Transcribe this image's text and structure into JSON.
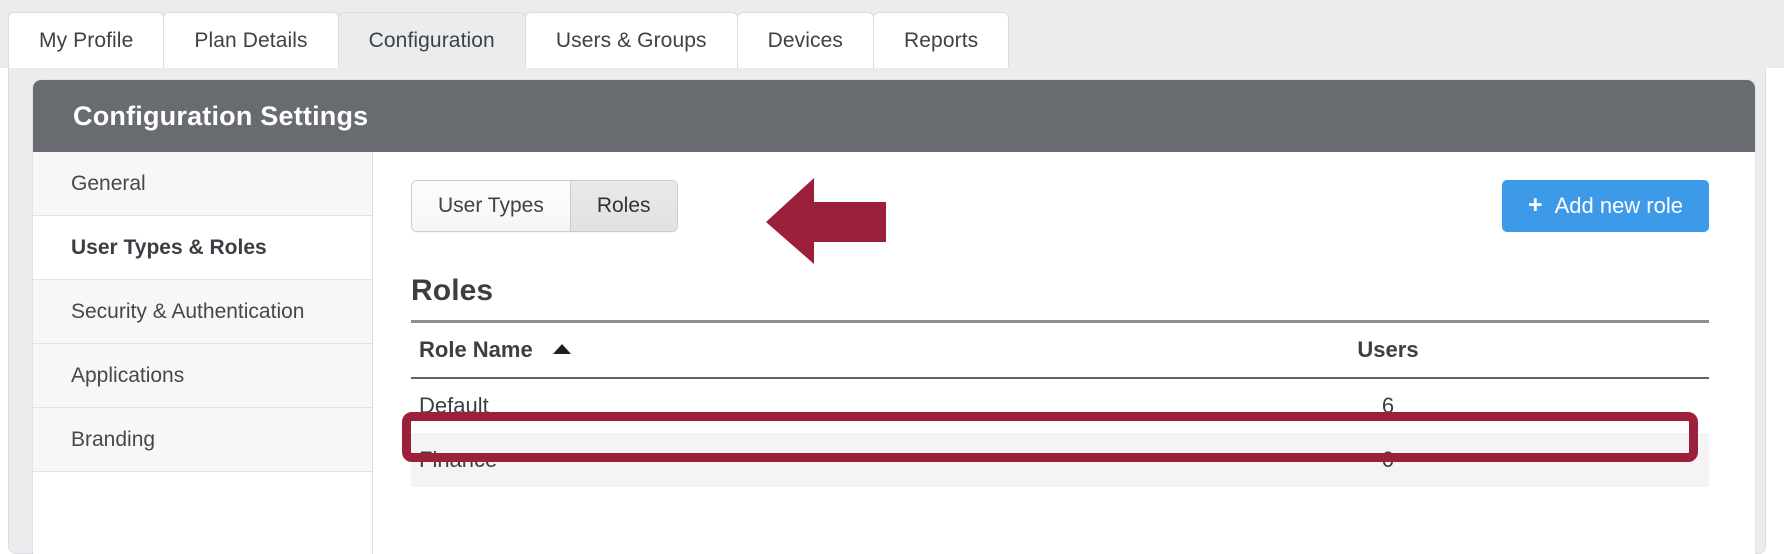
{
  "tabs": [
    {
      "label": "My Profile",
      "active": false
    },
    {
      "label": "Plan Details",
      "active": false
    },
    {
      "label": "Configuration",
      "active": true
    },
    {
      "label": "Users & Groups",
      "active": false
    },
    {
      "label": "Devices",
      "active": false
    },
    {
      "label": "Reports",
      "active": false
    }
  ],
  "card": {
    "header_title": "Configuration Settings"
  },
  "sidebar": {
    "items": [
      {
        "label": "General",
        "active": false
      },
      {
        "label": "User Types & Roles",
        "active": true
      },
      {
        "label": "Security & Authentication",
        "active": false
      },
      {
        "label": "Applications",
        "active": false
      },
      {
        "label": "Branding",
        "active": false
      }
    ]
  },
  "toolbar": {
    "segmented": [
      {
        "label": "User Types",
        "active": false
      },
      {
        "label": "Roles",
        "active": true
      }
    ],
    "add_button": {
      "icon": "plus-icon",
      "glyph": "+",
      "label": "Add new role"
    }
  },
  "main": {
    "section_title": "Roles",
    "table": {
      "columns": [
        {
          "label": "Role Name",
          "sort": "ascending",
          "sort_icon": "caret-up-icon"
        },
        {
          "label": "Users",
          "sort": null
        }
      ],
      "rows": [
        {
          "role_name": "Default",
          "users": "6",
          "highlighted": false
        },
        {
          "role_name": "Finance",
          "users": "0",
          "highlighted": true
        }
      ]
    }
  },
  "annotations": {
    "arrow": {
      "icon": "left-arrow-annotation-icon",
      "direction": "left",
      "color": "#9c2039",
      "points_to": "Roles"
    },
    "highlight_box": {
      "icon": "highlight-rectangle-annotation",
      "color": "#9c2039",
      "targets": "Finance"
    }
  },
  "colors": {
    "accent_blue": "#3c9ae8",
    "annotation_red": "#9c2039",
    "header_gray": "#686b70"
  }
}
